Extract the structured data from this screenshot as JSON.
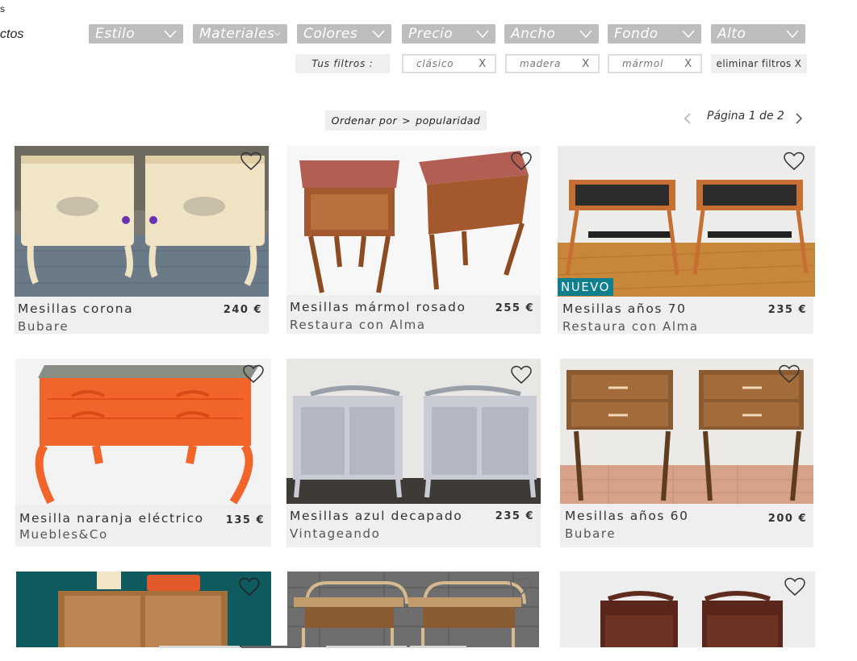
{
  "sidebar": {
    "fragment_top": "s",
    "fragment_bottom": "ctos"
  },
  "filters": [
    "Estilo",
    "Materiales",
    "Colores",
    "Precio",
    "Ancho",
    "Fondo",
    "Alto"
  ],
  "active_filters": {
    "label": "Tus filtros :",
    "chips": [
      "clásico",
      "madera",
      "mármol"
    ],
    "remove_glyph": "X",
    "clear_label": "eliminar filtros X"
  },
  "sort": {
    "label": "Ordenar por",
    "separator": ">",
    "value": "popularidad"
  },
  "pagination": {
    "prev": "<",
    "text": "Página 1 de 2",
    "next": ">"
  },
  "products": [
    {
      "name": "Mesillas corona",
      "shop": "Bubare",
      "price": "240 €"
    },
    {
      "name": "Mesillas mármol rosado",
      "shop": "Restaura con Alma",
      "price": "255 €"
    },
    {
      "name": "Mesillas años 70",
      "shop": "Restaura con Alma",
      "price": "235 €",
      "badge": "NUEVO"
    },
    {
      "name": "Mesilla naranja eléctrico",
      "shop": "Muebles&Co",
      "price": "135 €"
    },
    {
      "name": "Mesillas azul decapado",
      "shop": "Vintageando",
      "price": "235 €"
    },
    {
      "name": "Mesillas años 60",
      "shop": "Bubare",
      "price": "200 €"
    },
    {
      "name": "",
      "shop": "",
      "price": ""
    },
    {
      "name": "",
      "shop": "",
      "price": ""
    },
    {
      "name": "",
      "shop": "",
      "price": ""
    }
  ],
  "colors": {
    "badge": "#0e7f8c",
    "filter_bg": "#bdbdbd",
    "chip_bg": "#efefef"
  }
}
